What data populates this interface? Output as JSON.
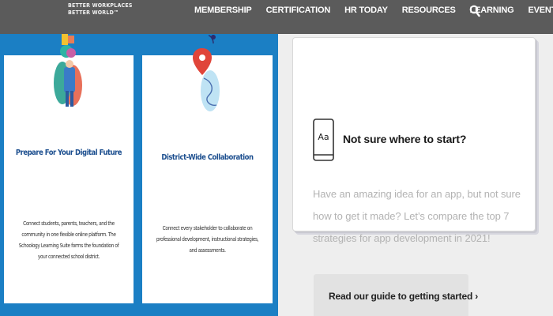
{
  "header": {
    "logo_lines": [
      "BETTER WORKPLACES",
      "BETTER WORLD™"
    ],
    "nav": [
      "MEMBERSHIP",
      "CERTIFICATION",
      "HR TODAY",
      "RESOURCES",
      "LEARNING",
      "EVENTS"
    ],
    "search_icon": "search-icon"
  },
  "cards": [
    {
      "title": "Prepare For Your Digital Future",
      "body": "Connect students, parents, teachers, and the community in one flexible online platform. The Schoology Learning Suite forms the foundation of your connected school district."
    },
    {
      "title": "District-Wide Collaboration",
      "body": "Connect every stakeholder to collaborate on professional development, instructional strategies, and assessments."
    }
  ],
  "info": {
    "icon_label": "Aa",
    "title": "Not sure where to start?",
    "text": "Have an amazing idea for an app, but not sure how to get it made? Let’s compare the top 7 strategies for app development in 2021!",
    "cta": "Read our guide to getting started ›"
  },
  "colors": {
    "nav_bg": "#5b5b5b",
    "panel_blue": "#1b7fc4",
    "card_title": "#1d4f8f",
    "page_bg": "#eeeeee"
  }
}
